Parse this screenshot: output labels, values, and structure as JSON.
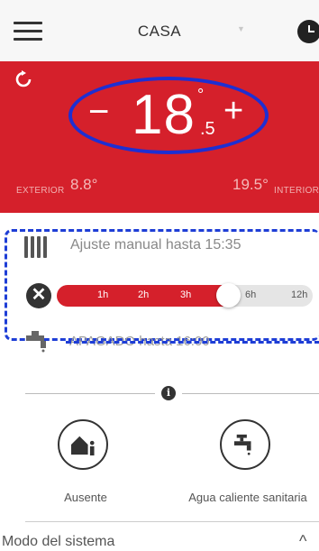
{
  "header": {
    "title": "CASA",
    "menu_icon": "hamburger-menu-icon",
    "clock_icon": "clock-icon"
  },
  "thermostat": {
    "setpoint_integer": "18",
    "setpoint_decimal": ".5",
    "degree": "°",
    "minus_label": "−",
    "plus_label": "+",
    "exterior_label": "EXTERIOR",
    "exterior_value": "8.8°",
    "interior_value": "19.5°",
    "interior_label": "INTERIOR",
    "accent_color": "#d5202b",
    "annotation_color": "#1e2fd2"
  },
  "heating": {
    "status_text": "Ajuste manual hasta 15:35",
    "cancel_symbol": "✕",
    "duration_options": [
      "1h",
      "2h",
      "3h",
      "6h",
      "12h"
    ],
    "selected_fraction": 0.66
  },
  "water": {
    "status_text": "APAGADO hasta 16:00"
  },
  "actions": {
    "info_symbol": "i",
    "away_label": "Ausente",
    "dhw_label": "Agua caliente sanitaria"
  },
  "footer": {
    "mode_label": "Modo del sistema",
    "chevron": "^"
  }
}
